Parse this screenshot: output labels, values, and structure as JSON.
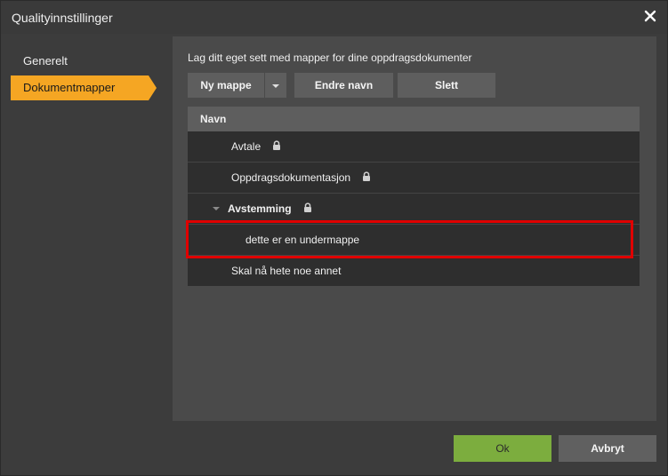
{
  "window": {
    "title": "Qualityinnstillinger"
  },
  "sidebar": {
    "items": [
      {
        "label": "Generelt",
        "active": false
      },
      {
        "label": "Dokumentmapper",
        "active": true
      }
    ]
  },
  "main": {
    "intro": "Lag ditt eget sett med mapper for dine oppdragsdokumenter",
    "toolbar": {
      "new_label": "Ny mappe",
      "rename_label": "Endre navn",
      "delete_label": "Slett"
    },
    "table": {
      "header": "Navn",
      "rows": [
        {
          "label": "Avtale",
          "locked": true
        },
        {
          "label": "Oppdragsdokumentasjon",
          "locked": true
        },
        {
          "label": "Avstemming",
          "locked": true,
          "expanded": true
        },
        {
          "label": "dette er en undermappe",
          "locked": false
        },
        {
          "label": "Skal nå hete noe annet",
          "locked": false
        }
      ]
    }
  },
  "footer": {
    "ok_label": "Ok",
    "cancel_label": "Avbryt"
  },
  "colors": {
    "accent": "#f5a623",
    "ok": "#7cad3e",
    "highlight": "#e00000"
  }
}
